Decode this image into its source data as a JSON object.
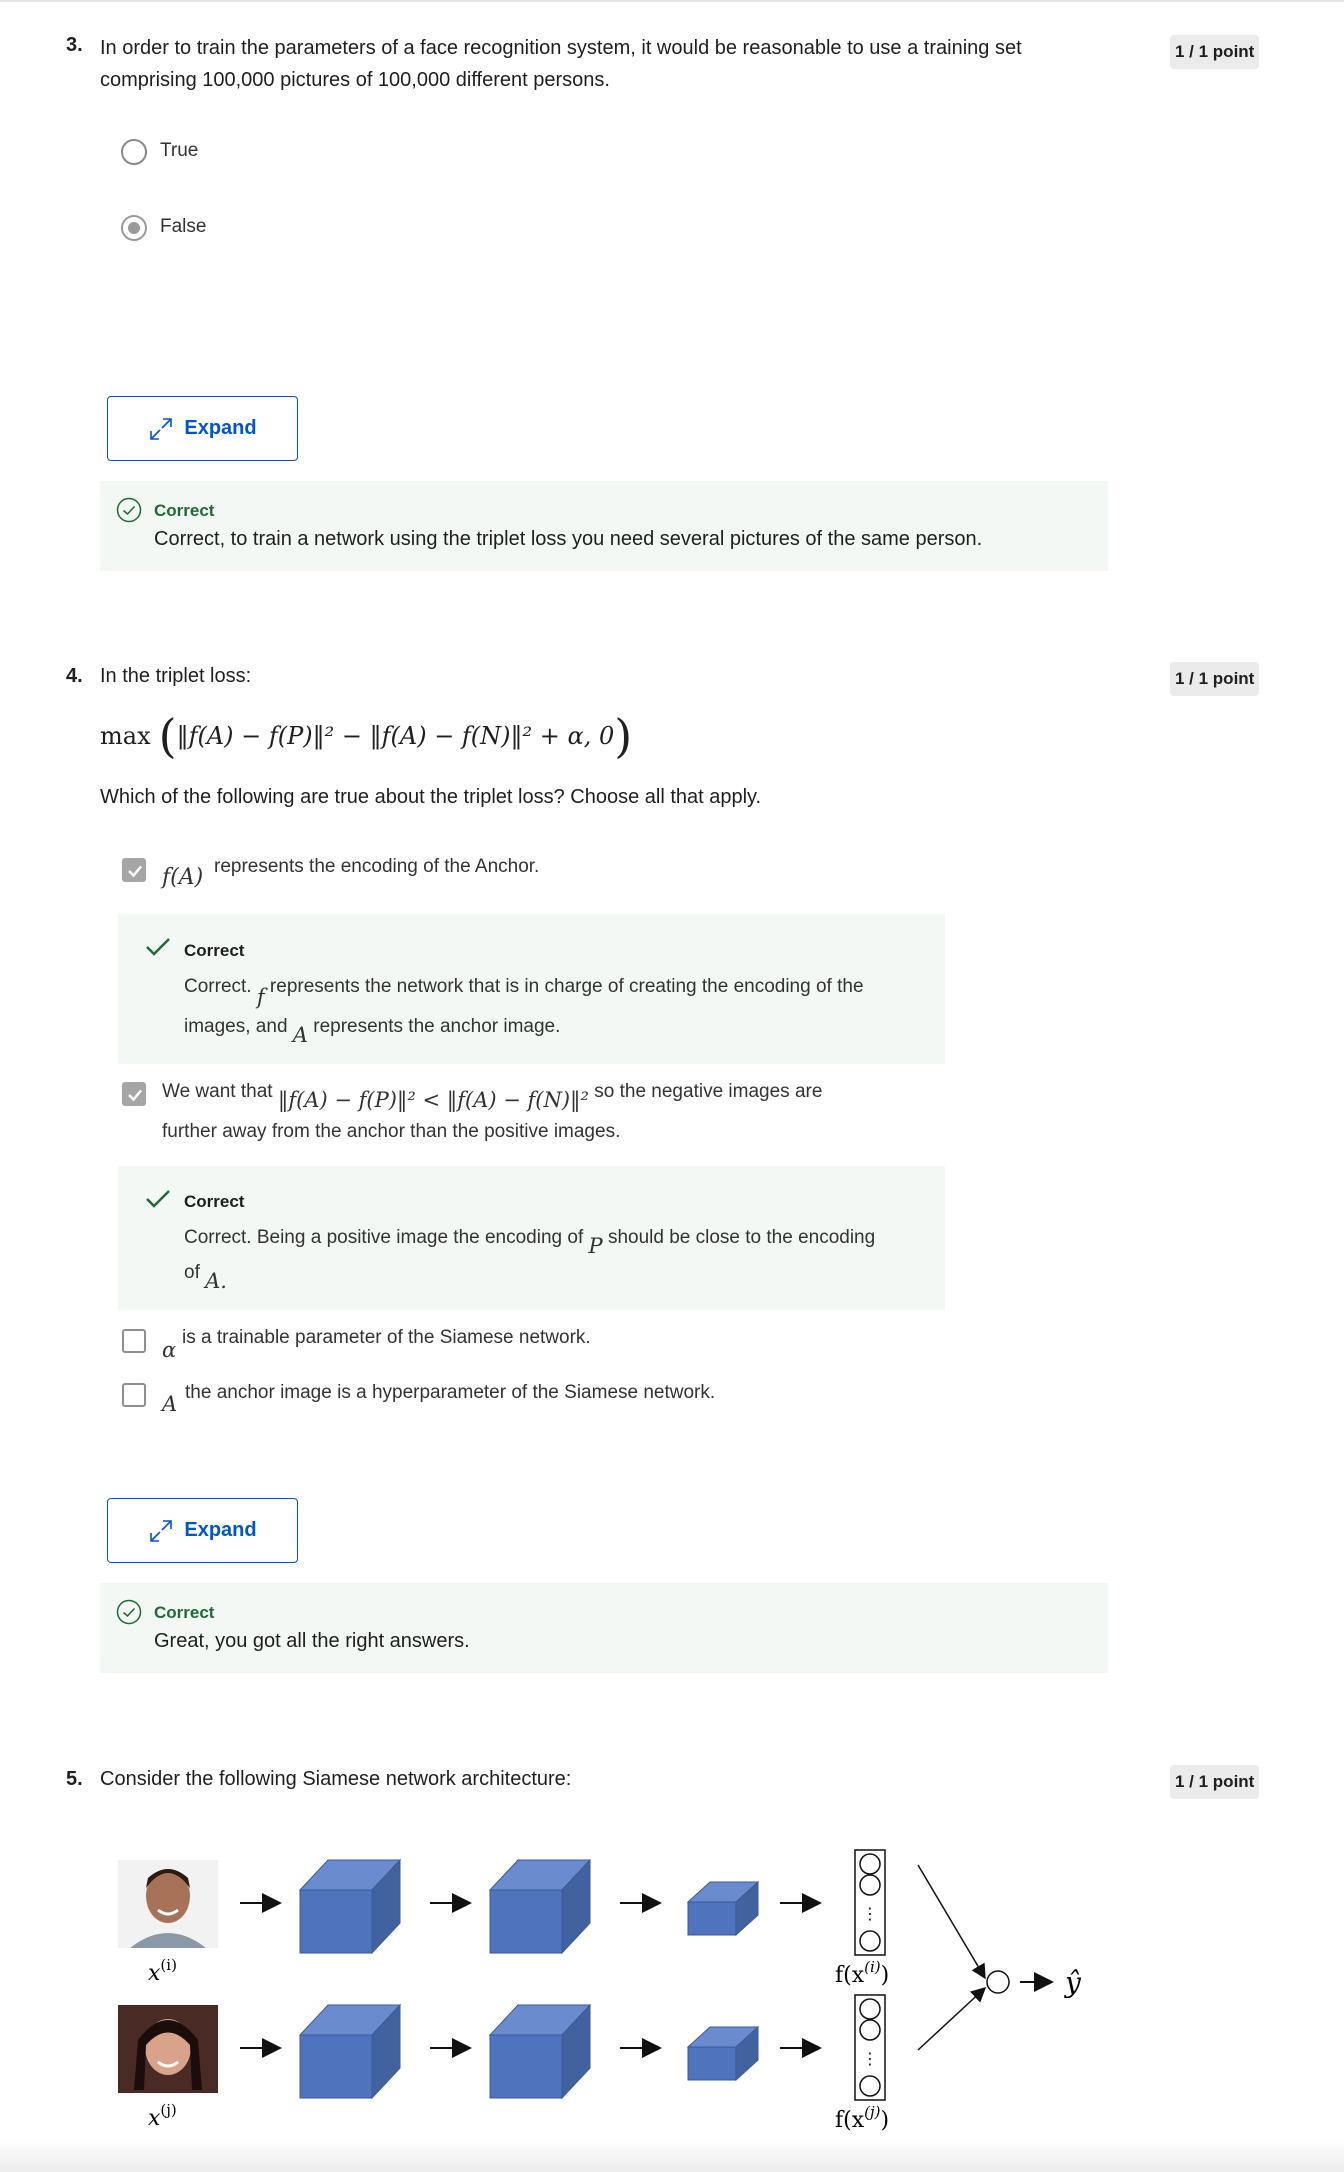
{
  "q3": {
    "number": "3.",
    "text_line1": "In order to train the parameters of a face recognition system, it would be reasonable to use a training set",
    "text_line2": "comprising 100,000 pictures of 100,000 different persons.",
    "score": "1 / 1 point",
    "options": [
      {
        "label": "True",
        "selected": false
      },
      {
        "label": "False",
        "selected": true
      }
    ],
    "expand_label": "Expand",
    "feedback_title": "Correct",
    "feedback_text": "Correct, to train a network using the triplet loss you need several pictures of the same person."
  },
  "q4": {
    "number": "4.",
    "text": "In the triplet loss:",
    "formula_max": "max",
    "formula_body": "‖f(A) − f(P)‖² − ‖f(A) − f(N)‖² + α, 0",
    "instruction": "Which of the following are true about the triplet loss? Choose all that apply.",
    "score": "1 / 1 point",
    "choice1_math": "f(A)",
    "choice1_text": "represents the encoding of the Anchor.",
    "choice1_fb_title": "Correct",
    "choice1_fb_pre": "Correct.",
    "choice1_fb_f": "f",
    "choice1_fb_mid": "represents the network that is in charge of creating the encoding of the",
    "choice1_fb_line2a": "images, and",
    "choice1_fb_A": "A",
    "choice1_fb_line2b": "represents the anchor image.",
    "choice2_pre": "We want that",
    "choice2_math": "‖f(A) − f(P)‖² < ‖f(A) − f(N)‖²",
    "choice2_post": "so the negative images are",
    "choice2_line2": "further away from the anchor than the positive images.",
    "choice2_fb_title": "Correct",
    "choice2_fb_text": "Correct. Being a positive image the encoding of",
    "choice2_fb_P": "P",
    "choice2_fb_post": "should be close to the encoding",
    "choice2_fb_line2": "of",
    "choice2_fb_A": "A.",
    "choice3_math": "α",
    "choice3_text": "is a trainable parameter of the Siamese network.",
    "choice4_math": "A",
    "choice4_text": "the anchor image is a hyperparameter of the Siamese network.",
    "expand_label": "Expand",
    "feedback_title": "Correct",
    "feedback_text": "Great, you got all the right answers."
  },
  "q5": {
    "number": "5.",
    "text": "Consider the following Siamese network architecture:",
    "score": "1 / 1 point",
    "diagram": {
      "input1_label": "x",
      "input1_sup": "(i)",
      "input2_label": "x",
      "input2_sup": "(j)",
      "enc1_label": "f(x",
      "enc1_sup": "(i)",
      "enc2_label": "f(x",
      "enc2_sup": "(j)",
      "paren": ")",
      "output_label": "ŷ",
      "cube_color": "#4f73bd"
    }
  },
  "colors": {
    "accent": "#0056d2",
    "correct_green": "#1e6b33",
    "feedback_bg": "#f3f8f4"
  }
}
